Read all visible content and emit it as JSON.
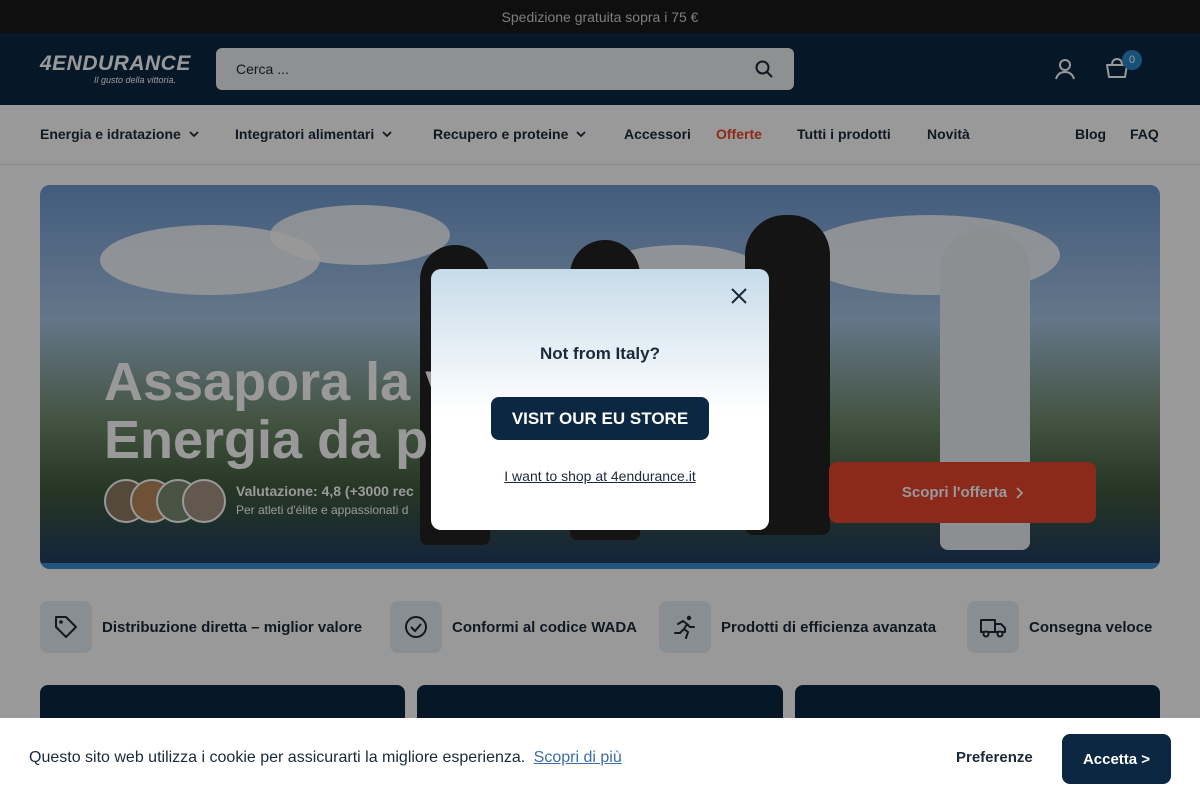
{
  "topbar": {
    "text": "Spedizione gratuita sopra i 75 €"
  },
  "header": {
    "logo_main": "4ENDURANCE",
    "logo_tagline": "Il gusto della vittoria.",
    "search_placeholder": "Cerca ...",
    "cart_count": "0"
  },
  "nav": {
    "items": [
      {
        "label": "Energia e idratazione"
      },
      {
        "label": "Integratori alimentari"
      },
      {
        "label": "Recupero e proteine"
      },
      {
        "label": "Accessori"
      },
      {
        "label": "Offerte"
      },
      {
        "label": "Tutti i prodotti"
      },
      {
        "label": "Novità"
      },
      {
        "label": "Blog"
      },
      {
        "label": "FAQ"
      }
    ]
  },
  "hero": {
    "title_line1": "Assapora la vi",
    "title_line2": "Energia da pro",
    "rating": "Valutazione: 4,8 (+3000 rec",
    "rating_sub": "Per atleti d'élite e appassionati d",
    "cta": "Scopri l'offerta"
  },
  "features": [
    {
      "icon": "tag-icon",
      "label": "Distribuzione diretta – miglior valore"
    },
    {
      "icon": "check-badge-icon",
      "label": "Conformi al codice WADA"
    },
    {
      "icon": "runner-icon",
      "label": "Prodotti di efficienza avanzata"
    },
    {
      "icon": "delivery-truck-icon",
      "label": "Consegna veloce"
    }
  ],
  "modal": {
    "title": "Not from Italy?",
    "button": "VISIT OUR EU STORE",
    "link": "I want to shop at 4endurance.it"
  },
  "cookie": {
    "text": "Questo sito web utilizza i cookie per assicurarti la migliore esperienza.",
    "learn_more": "Scopri di più",
    "preferences": "Preferenze",
    "accept": "Accetta >"
  },
  "colors": {
    "brand_navy": "#0b2741",
    "accent_orange": "#e8452c",
    "accent_blue": "#2a87c9"
  }
}
